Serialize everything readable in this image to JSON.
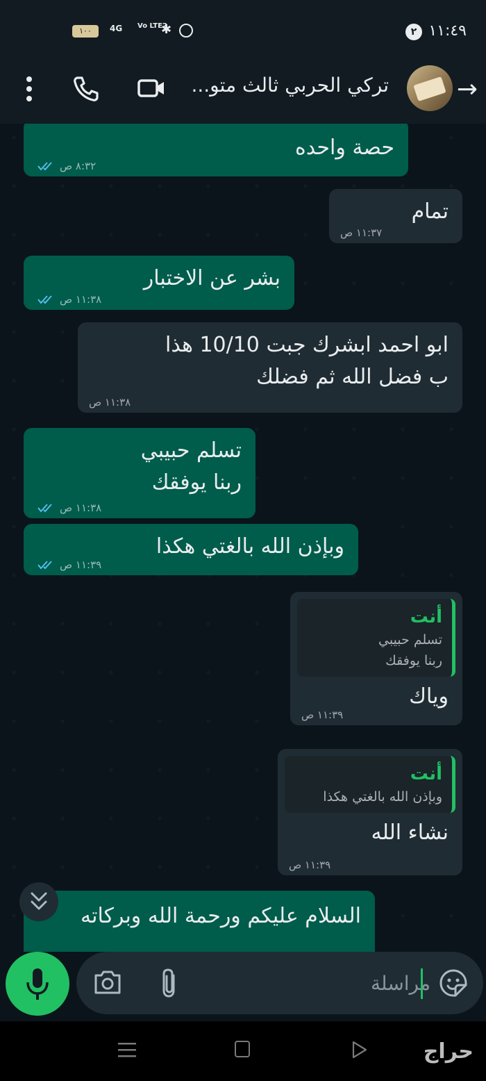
{
  "status_bar": {
    "time": "١١:٤٩",
    "notification_count": "٢",
    "battery": "١٠٠",
    "network": "4G",
    "volte": "Vo LTE2",
    "icons": [
      "bluetooth-icon",
      "alarm-icon",
      "signal-icon",
      "battery-icon"
    ]
  },
  "header": {
    "contact_name": "تركي الحربي ثالث متو...",
    "icons": [
      "back-arrow-icon",
      "video-call-icon",
      "voice-call-icon",
      "more-menu-icon"
    ]
  },
  "messages": [
    {
      "direction": "out",
      "lines": [
        "حصة واحده"
      ],
      "time": "٨:٣٢ ص",
      "status": "read"
    },
    {
      "direction": "in",
      "lines": [
        "تمام"
      ],
      "time": "١١:٣٧ ص"
    },
    {
      "direction": "out",
      "lines": [
        "بشر عن الاختبار"
      ],
      "time": "١١:٣٨ ص",
      "status": "read"
    },
    {
      "direction": "in",
      "lines": [
        "ابو احمد ابشرك جبت 10/10 هذا",
        "ب فضل الله ثم فضلك"
      ],
      "time": "١١:٣٨ ص"
    },
    {
      "direction": "out",
      "lines": [
        "تسلم حبيبي",
        "ربنا يوفقك"
      ],
      "time": "١١:٣٨ ص",
      "status": "read"
    },
    {
      "direction": "out",
      "lines": [
        "وبإذن الله بالغتي هكذا"
      ],
      "time": "١١:٣٩ ص",
      "status": "read"
    },
    {
      "direction": "in",
      "quote": {
        "author": "أنت",
        "lines": [
          "تسلم حبيبي",
          "ربنا يوفقك"
        ]
      },
      "lines": [
        "وياك"
      ],
      "time": "١١:٣٩ ص"
    },
    {
      "direction": "in",
      "quote": {
        "author": "أنت",
        "lines": [
          "وبإذن الله بالغتي هكذا"
        ]
      },
      "lines": [
        "نشاء الله"
      ],
      "time": "١١:٣٩ ص"
    },
    {
      "direction": "out",
      "lines": [
        "السلام عليكم ورحمة الله وبركاته"
      ],
      "time": "",
      "status": ""
    }
  ],
  "input": {
    "placeholder": "مراسلة",
    "value": ""
  },
  "colors": {
    "outgoing_bubble": "#005c4b",
    "incoming_bubble": "#202c33",
    "accent": "#21c063",
    "read_ticks": "#53bdeb",
    "background": "#0b141a"
  },
  "watermark": "حراج"
}
